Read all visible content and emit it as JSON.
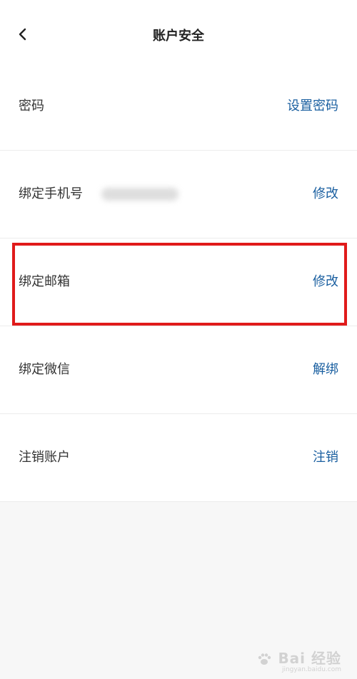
{
  "header": {
    "title": "账户安全",
    "back_icon": "chevron-left-icon"
  },
  "rows": [
    {
      "label": "密码",
      "action": "设置密码"
    },
    {
      "label": "绑定手机号",
      "action": "修改",
      "value_blurred": true
    },
    {
      "label": "绑定邮箱",
      "action": "修改",
      "highlighted": true
    },
    {
      "label": "绑定微信",
      "action": "解绑"
    },
    {
      "label": "注销账户",
      "action": "注销"
    }
  ],
  "colors": {
    "action": "#1a5fa0",
    "highlight": "#e01a1a",
    "background": "#f7f7f7"
  },
  "watermark": {
    "main": "Bai 经验",
    "sub": "jingyan.baidu.com"
  }
}
